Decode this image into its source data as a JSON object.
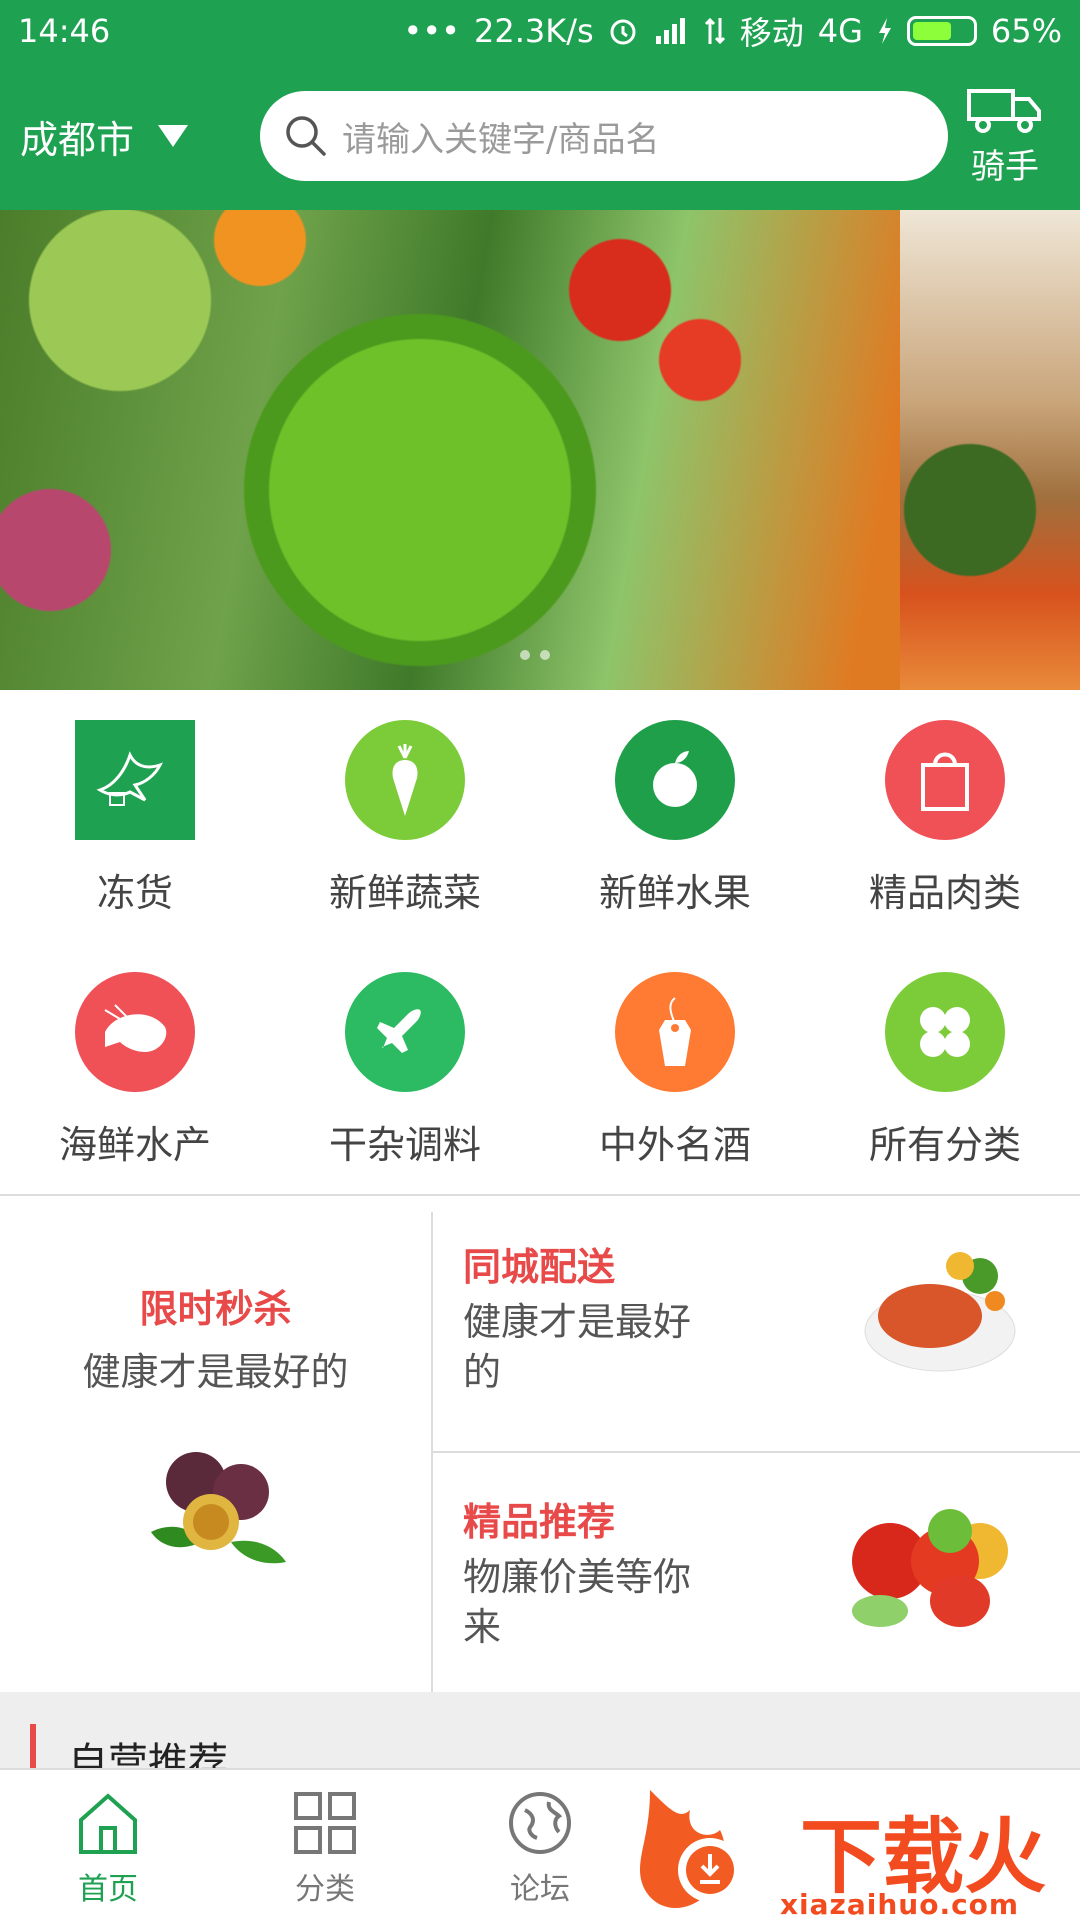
{
  "status_bar": {
    "time": "14:46",
    "dots": "•••",
    "speed": "22.3K/s",
    "carrier": "移动",
    "network": "4G",
    "battery": "65%",
    "battery_level": 0.65
  },
  "header": {
    "city": "成都市",
    "search_placeholder": "请输入关键字/商品名",
    "rider_label": "骑手",
    "accent_color": "#1fa152"
  },
  "categories": [
    {
      "label": "冻货",
      "icon": "dove-icon",
      "color": "#1fa152"
    },
    {
      "label": "新鲜蔬菜",
      "icon": "carrot-icon",
      "color": "#7ccc3a"
    },
    {
      "label": "新鲜水果",
      "icon": "apple-icon",
      "color": "#1f9f4a"
    },
    {
      "label": "精品肉类",
      "icon": "shopping-bag-icon",
      "color": "#ef5157"
    },
    {
      "label": "海鲜水产",
      "icon": "shrimp-icon",
      "color": "#ef5157"
    },
    {
      "label": "干杂调料",
      "icon": "airplane-icon",
      "color": "#2cbb62"
    },
    {
      "label": "中外名酒",
      "icon": "price-tag-icon",
      "color": "#ff7a33"
    },
    {
      "label": "所有分类",
      "icon": "clover-icon",
      "color": "#7ccc3a"
    }
  ],
  "promo": {
    "left": {
      "title": "限时秒杀",
      "subtitle": "健康才是最好的"
    },
    "right_top": {
      "title": "同城配送",
      "subtitle": "健康才是最好的"
    },
    "right_bottom": {
      "title": "精品推荐",
      "subtitle": "物廉价美等你来"
    }
  },
  "section": {
    "title": "自营推荐"
  },
  "bottom_nav": [
    {
      "label": "首页",
      "icon": "home-icon",
      "active": true
    },
    {
      "label": "分类",
      "icon": "grid-icon",
      "active": false
    },
    {
      "label": "论坛",
      "icon": "globe-icon",
      "active": false
    }
  ],
  "watermark": {
    "text": "下载火",
    "url": "xiazaihuo.com"
  }
}
